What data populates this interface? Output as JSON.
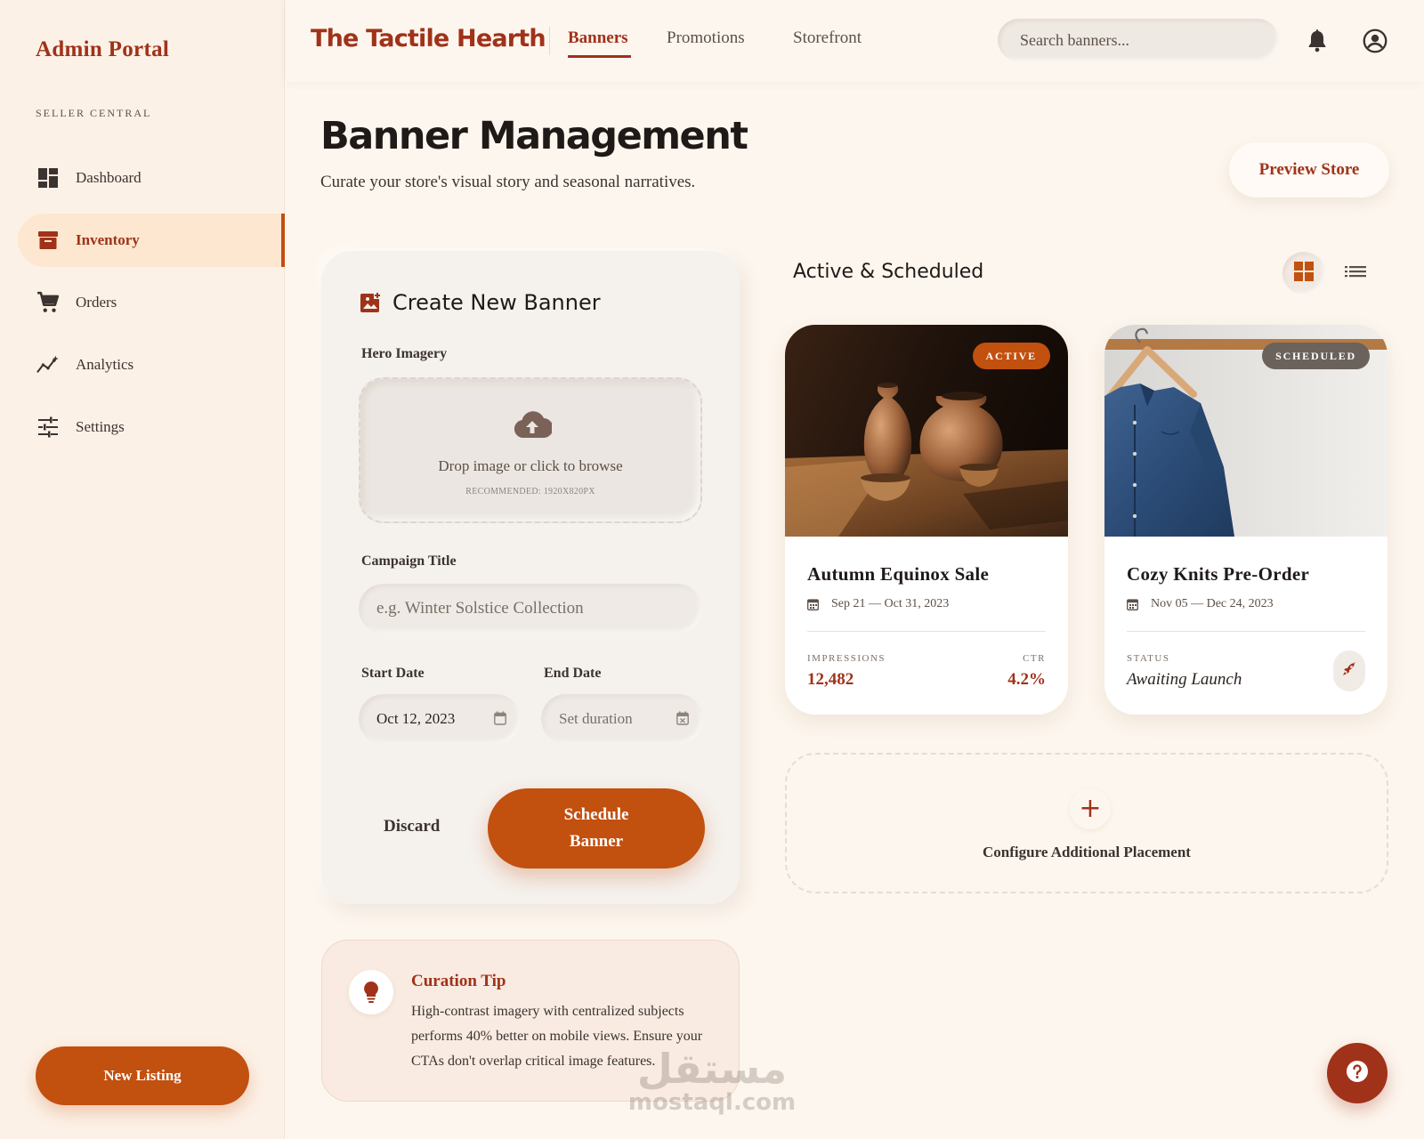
{
  "sidebar": {
    "brand": "Admin Portal",
    "section_label": "SELLER CENTRAL",
    "items": [
      {
        "label": "Dashboard",
        "icon": "dashboard-icon"
      },
      {
        "label": "Inventory",
        "icon": "inventory-icon",
        "active": true
      },
      {
        "label": "Orders",
        "icon": "cart-icon"
      },
      {
        "label": "Analytics",
        "icon": "analytics-icon"
      },
      {
        "label": "Settings",
        "icon": "settings-sliders-icon"
      }
    ],
    "new_listing_label": "New Listing"
  },
  "header": {
    "store_name": "The Tactile Hearth",
    "tabs": [
      {
        "label": "Banners",
        "active": true
      },
      {
        "label": "Promotions"
      },
      {
        "label": "Storefront"
      }
    ],
    "search_placeholder": "Search banners...",
    "icons": [
      "bell-icon",
      "account-icon"
    ]
  },
  "page": {
    "title": "Banner Management",
    "subtitle": "Curate your store's visual story and seasonal narratives.",
    "preview_label": "Preview Store"
  },
  "create": {
    "title": "Create New Banner",
    "hero_label": "Hero Imagery",
    "drop_text": "Drop image or click to browse",
    "drop_hint": "RECOMMENDED: 1920X820PX",
    "campaign_label": "Campaign Title",
    "campaign_placeholder": "e.g. Winter Solstice Collection",
    "start_label": "Start Date",
    "start_value": "Oct 12, 2023",
    "end_label": "End Date",
    "end_placeholder": "Set duration",
    "discard_label": "Discard",
    "schedule_line1": "Schedule",
    "schedule_line2": "Banner"
  },
  "tip": {
    "title": "Curation Tip",
    "body": "High-contrast imagery with centralized subjects performs 40% better on mobile views. Ensure your CTAs don't overlap critical image features."
  },
  "list": {
    "title": "Active & Scheduled",
    "cards": [
      {
        "badge": "ACTIVE",
        "title": "Autumn Equinox Sale",
        "dates": "Sep 21 — Oct 31, 2023",
        "metric1_label": "IMPRESSIONS",
        "metric1_value": "12,482",
        "metric2_label": "CTR",
        "metric2_value": "4.2%"
      },
      {
        "badge": "SCHEDULED",
        "title": "Cozy Knits Pre-Order",
        "dates": "Nov 05 — Dec 24, 2023",
        "status_label": "STATUS",
        "status_value": "Awaiting Launch"
      }
    ],
    "add_label": "Configure Additional Placement",
    "add_symbol": "+"
  },
  "watermark": {
    "arabic": "مستقل",
    "latin": "mostaql.com"
  },
  "colors": {
    "accent": "#a0321a",
    "button": "#c2500f",
    "background": "#fdf6ee",
    "scheduled_badge": "#6b625c"
  }
}
